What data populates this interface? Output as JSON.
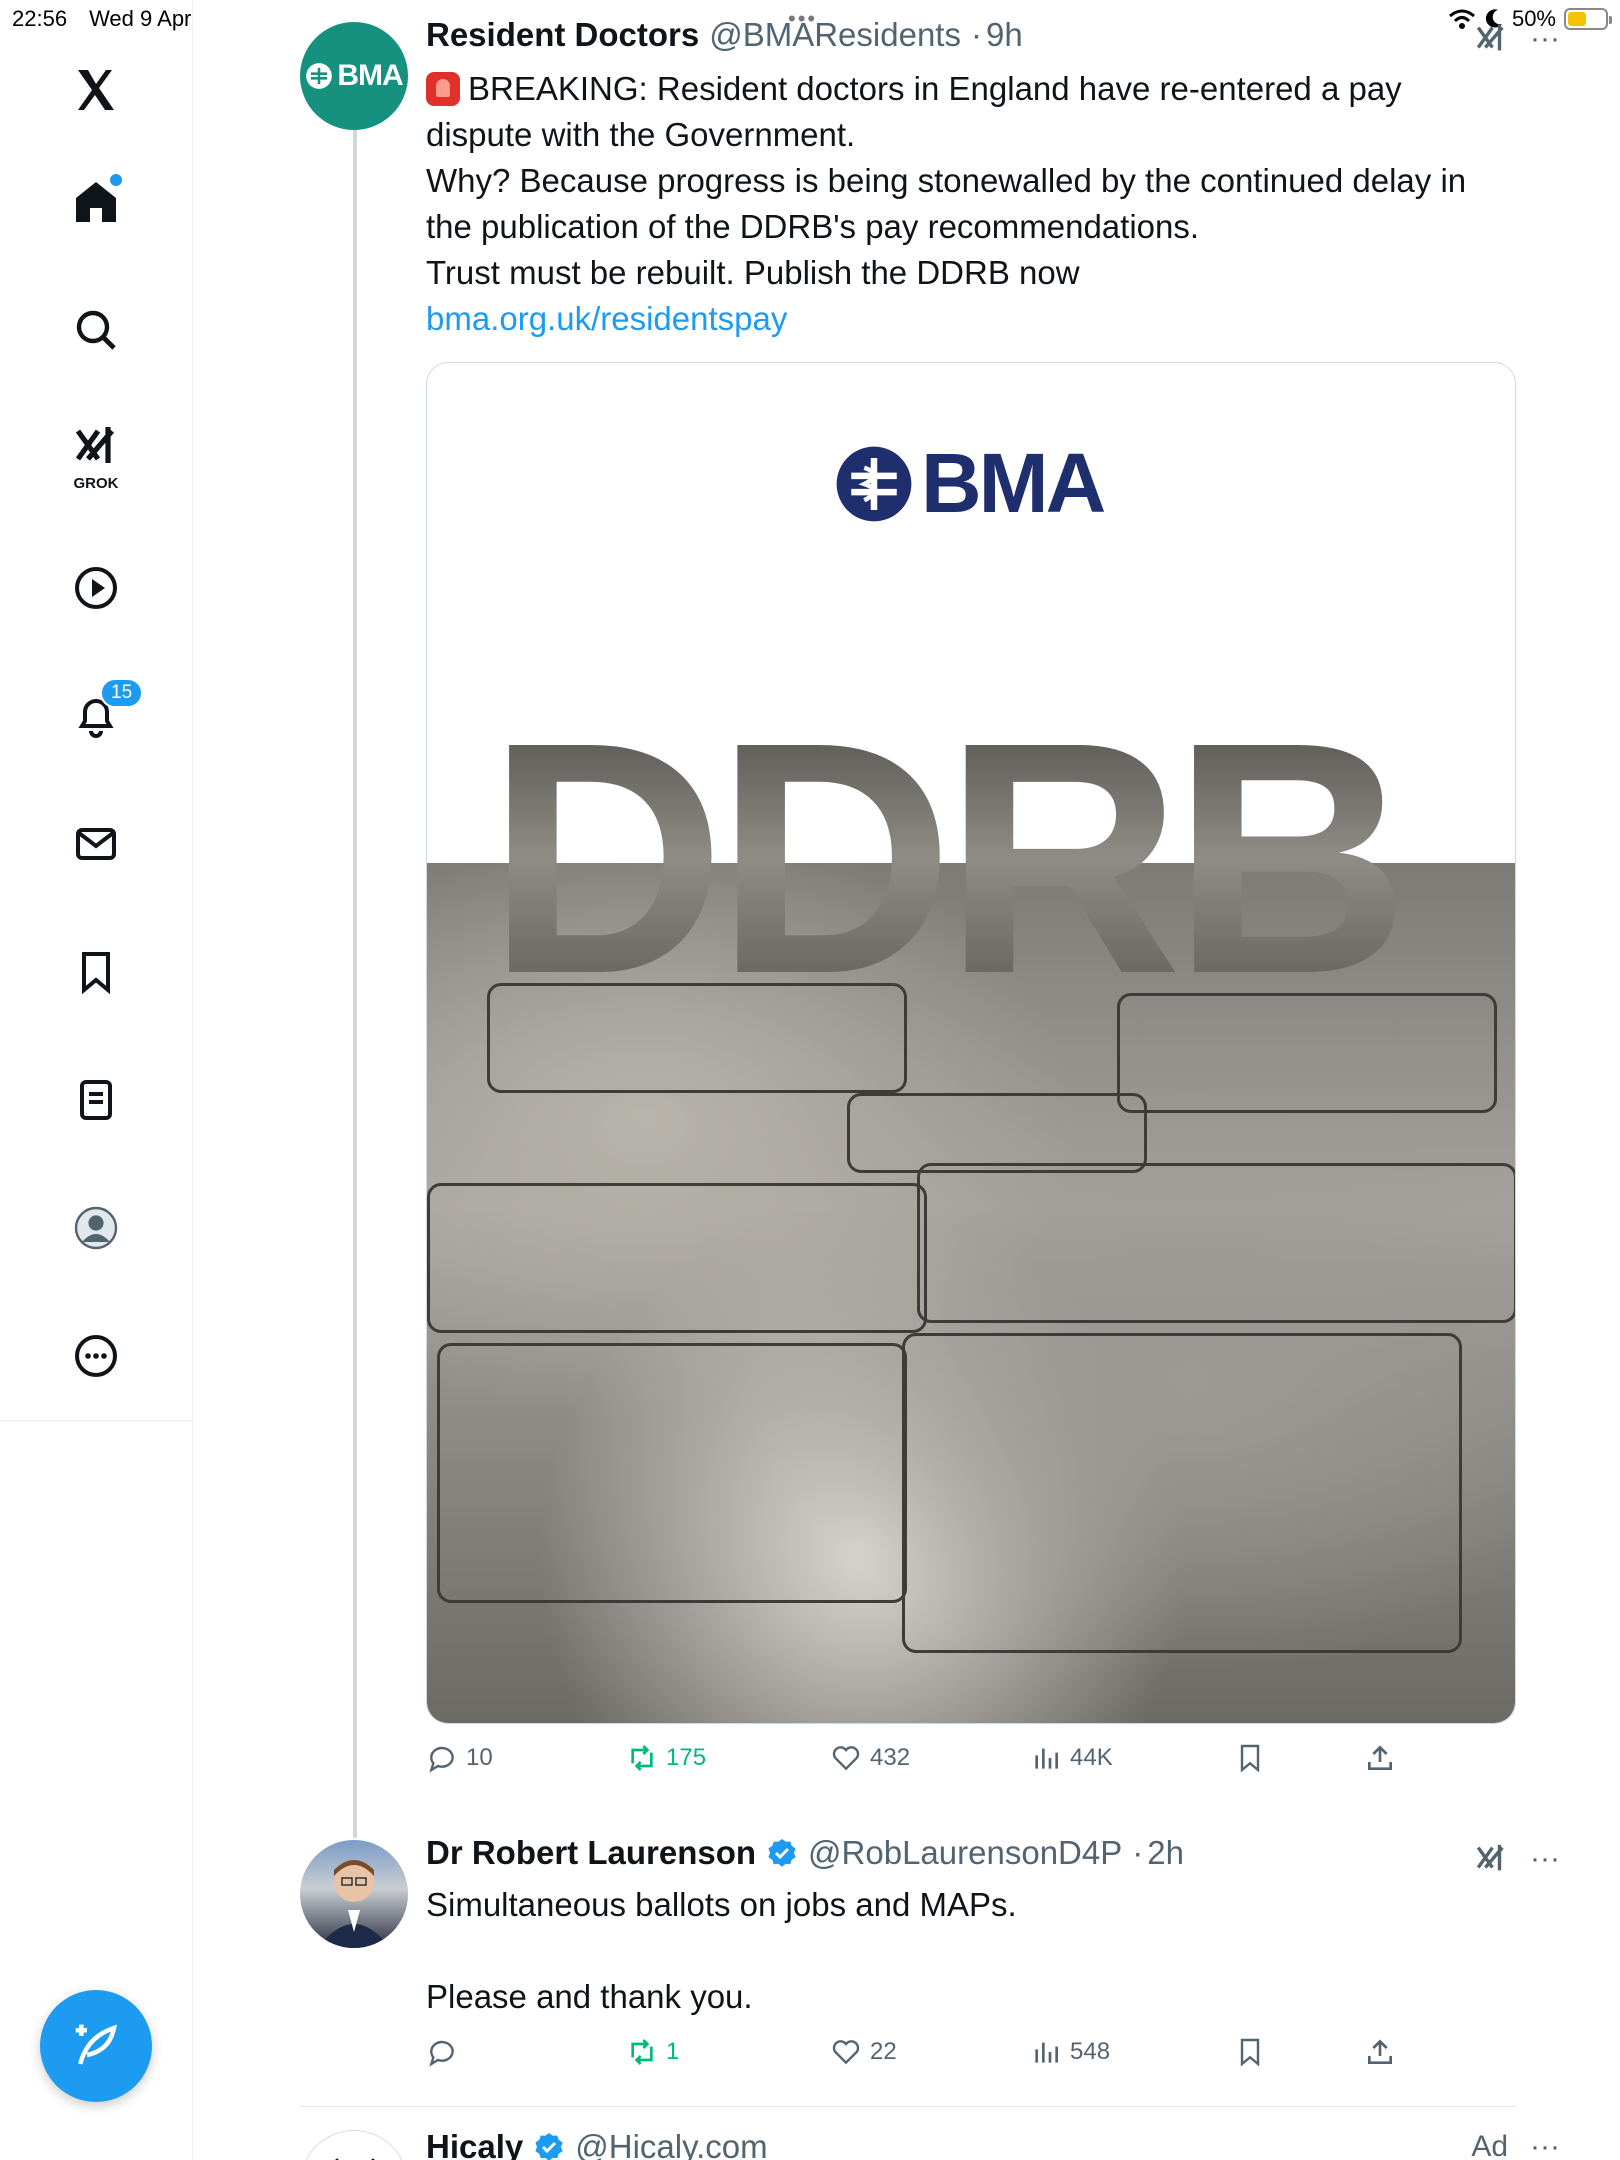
{
  "status_bar": {
    "time": "22:56",
    "date": "Wed 9 Apr",
    "battery_percent": "50%",
    "battery_level": 0.5,
    "top_dots": "•••"
  },
  "sidebar": {
    "items": [
      {
        "name": "home",
        "icon": "home-icon"
      },
      {
        "name": "explore",
        "icon": "search-icon"
      },
      {
        "name": "grok",
        "icon": "grok-icon",
        "label": "GROK"
      },
      {
        "name": "videos",
        "icon": "play-icon"
      },
      {
        "name": "notifications",
        "icon": "bell-icon",
        "badge": "15"
      },
      {
        "name": "messages",
        "icon": "mail-icon"
      },
      {
        "name": "bookmarks",
        "icon": "bookmark-icon"
      },
      {
        "name": "lists",
        "icon": "list-icon"
      },
      {
        "name": "profile",
        "icon": "avatar-icon"
      },
      {
        "name": "more",
        "icon": "more-icon"
      }
    ],
    "compose_icon": "compose-icon"
  },
  "tweets": [
    {
      "name": "Resident Doctors",
      "handle": "@BMAResidents",
      "time": "9h",
      "avatar_text": "BMA",
      "text_line1": "BREAKING: Resident doctors in England have re-entered a pay dispute with the Government.",
      "text_line2": "Why? Because progress is being stonewalled by the continued delay in the publication of the DDRB's pay recommendations.",
      "text_line3": "Trust must be rebuilt. Publish the DDRB now",
      "link": "bma.org.uk/residentspay",
      "media": {
        "logo_text": "BMA",
        "headline": "DDRB"
      },
      "stats": {
        "replies": "10",
        "reposts": "175",
        "likes": "432",
        "views": "44K"
      }
    },
    {
      "name": "Dr Robert Laurenson",
      "handle": "@RobLaurensonD4P",
      "time": "2h",
      "text_line1": "Simultaneous ballots on jobs and MAPs.",
      "text_line2": "Please and thank you.",
      "stats": {
        "replies": "",
        "reposts": "1",
        "likes": "22",
        "views": "548"
      }
    },
    {
      "name": "Hicaly",
      "handle": "@Hicaly.com",
      "ad_label": "Ad"
    }
  ],
  "colors": {
    "accent": "#1d9bf0",
    "repost_green": "#00ba7c",
    "bma_teal": "#16917f",
    "bma_navy": "#1f2f6e"
  }
}
